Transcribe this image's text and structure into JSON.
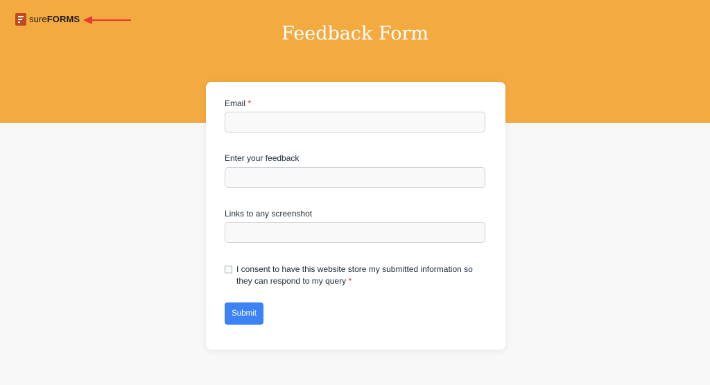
{
  "header": {
    "logo": {
      "text_sure": "sure",
      "text_forms": "FORMS"
    },
    "title": "Feedback Form",
    "background_color": "#f3aa41",
    "annotation_arrow_color": "#e53e2d"
  },
  "form": {
    "email": {
      "label": "Email",
      "required_mark": "*",
      "value": "",
      "placeholder": ""
    },
    "feedback": {
      "label": "Enter your feedback",
      "value": "",
      "placeholder": ""
    },
    "screenshot_links": {
      "label": "Links to any screenshot",
      "value": "",
      "placeholder": ""
    },
    "consent": {
      "label": "I consent to have this website store my submitted information so they can respond to my query",
      "required_mark": "*",
      "checked": false
    },
    "submit_label": "Submit",
    "submit_color": "#3b82f6"
  }
}
